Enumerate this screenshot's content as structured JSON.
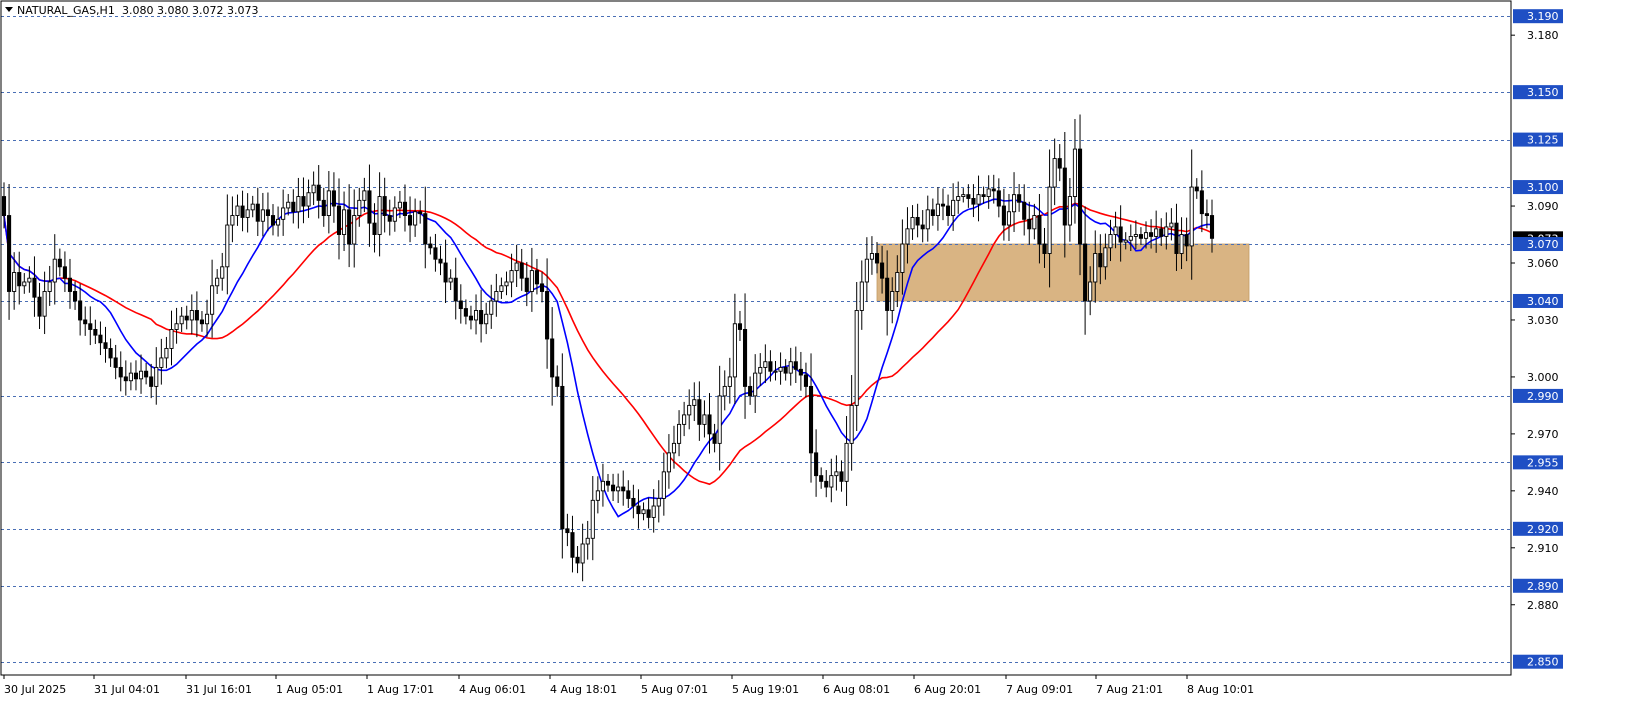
{
  "header": {
    "symbol": "NATURAL_GAS,H1",
    "ohlc": "3.080 3.080 3.072 3.073"
  },
  "colors": {
    "background": "#ffffff",
    "candle": "#000000",
    "ma_fast": "#0000ff",
    "ma_slow": "#ff0000",
    "level_line": "#4a6fb5",
    "level_tag": "#1f4fc4",
    "zone": "#d9b483"
  },
  "chart_data": {
    "type": "candlestick",
    "ylim": [
      2.843,
      3.198
    ],
    "y_ticks": [
      "3.180",
      "3.090",
      "3.060",
      "3.030",
      "3.000",
      "2.970",
      "2.940",
      "2.910",
      "2.880"
    ],
    "x_tick_labels": [
      "30 Jul 2025",
      "31 Jul 04:01",
      "31 Jul 16:01",
      "1 Aug 05:01",
      "1 Aug 17:01",
      "4 Aug 06:01",
      "4 Aug 18:01",
      "5 Aug 07:01",
      "5 Aug 19:01",
      "6 Aug 08:01",
      "6 Aug 20:01",
      "7 Aug 09:01",
      "7 Aug 21:01",
      "8 Aug 10:01"
    ],
    "levels": [
      "3.190",
      "3.150",
      "3.125",
      "3.100",
      "3.070",
      "3.040",
      "2.990",
      "2.955",
      "2.920",
      "2.890",
      "2.850"
    ],
    "current_price": "3.073",
    "zone": {
      "from_price": 3.04,
      "to_price": 3.07
    },
    "grid": false,
    "closes": [
      3.085,
      3.045,
      3.055,
      3.048,
      3.05,
      3.052,
      3.042,
      3.032,
      3.045,
      3.05,
      3.062,
      3.058,
      3.052,
      3.045,
      3.04,
      3.03,
      3.028,
      3.025,
      3.022,
      3.018,
      3.015,
      3.01,
      3.005,
      3.0,
      2.998,
      3.002,
      2.999,
      3.003,
      3.0,
      2.995,
      3.005,
      3.01,
      3.015,
      3.025,
      3.028,
      3.032,
      3.03,
      3.035,
      3.03,
      3.028,
      3.033,
      3.048,
      3.052,
      3.058,
      3.08,
      3.085,
      3.09,
      3.084,
      3.088,
      3.091,
      3.082,
      3.088,
      3.085,
      3.08,
      3.083,
      3.089,
      3.092,
      3.087,
      3.095,
      3.09,
      3.097,
      3.101,
      3.093,
      3.085,
      3.098,
      3.09,
      3.075,
      3.088,
      3.07,
      3.085,
      3.093,
      3.098,
      3.081,
      3.075,
      3.095,
      3.085,
      3.082,
      3.089,
      3.092,
      3.085,
      3.08,
      3.087,
      3.086,
      3.07,
      3.068,
      3.062,
      3.06,
      3.05,
      3.052,
      3.04,
      3.036,
      3.032,
      3.03,
      3.035,
      3.028,
      3.033,
      3.04,
      3.045,
      3.048,
      3.05,
      3.056,
      3.06,
      3.052,
      3.045,
      3.056,
      3.049,
      3.045,
      3.02,
      3.0,
      2.995,
      2.92,
      2.918,
      2.905,
      2.902,
      2.912,
      2.915,
      2.935,
      2.94,
      2.945,
      2.943,
      2.94,
      2.942,
      2.94,
      2.936,
      2.932,
      2.928,
      2.93,
      2.926,
      2.932,
      2.936,
      2.95,
      2.96,
      2.965,
      2.975,
      2.98,
      2.985,
      2.988,
      2.975,
      2.98,
      2.97,
      2.965,
      2.99,
      2.995,
      3.0,
      3.028,
      3.025,
      2.995,
      2.99,
      3.002,
      3.005,
      3.008,
      3.003,
      3.003,
      3.005,
      3.002,
      3.008,
      3.004,
      3.001,
      2.995,
      2.96,
      2.948,
      2.945,
      2.942,
      2.948,
      2.95,
      2.945,
      2.965,
      2.985,
      3.035,
      3.05,
      3.062,
      3.065,
      3.06,
      3.052,
      3.035,
      3.045,
      3.055,
      3.07,
      3.078,
      3.084,
      3.08,
      3.078,
      3.088,
      3.085,
      3.091,
      3.09,
      3.085,
      3.093,
      3.095,
      3.096,
      3.094,
      3.091,
      3.096,
      3.095,
      3.099,
      3.098,
      3.09,
      3.08,
      3.087,
      3.096,
      3.092,
      3.083,
      3.078,
      3.085,
      3.07,
      3.065,
      3.1,
      3.115,
      3.11,
      3.08,
      3.095,
      3.12,
      3.07,
      3.04,
      3.05,
      3.065,
      3.058,
      3.068,
      3.075,
      3.079,
      3.071,
      3.072,
      3.074,
      3.075,
      3.073,
      3.076,
      3.074,
      3.078,
      3.074,
      3.079,
      3.081,
      3.065,
      3.075,
      3.069,
      3.1,
      3.098,
      3.086,
      3.085,
      3.073
    ]
  }
}
